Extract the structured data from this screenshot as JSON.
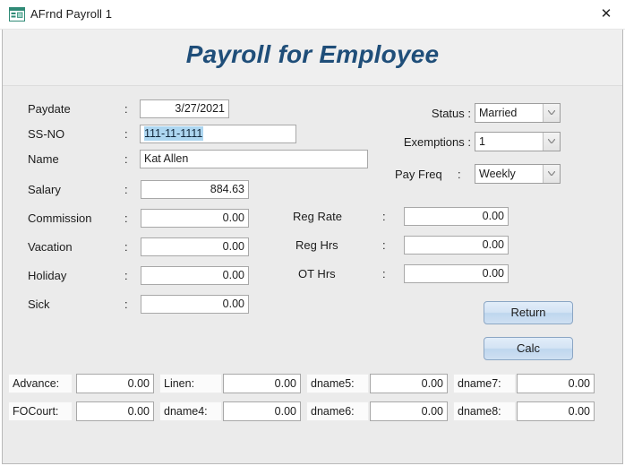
{
  "window": {
    "title": "AFrnd Payroll 1",
    "icon": "access-form-icon",
    "close_label": "✕"
  },
  "header": {
    "title": "Payroll for Employee",
    "title_color": "#1f4e79"
  },
  "colon": ":",
  "left_fields": [
    {
      "label": "Paydate",
      "value": "3/27/2021",
      "align": "right",
      "selected": false
    },
    {
      "label": "SS-NO",
      "value": "111-11-1111",
      "align": "left",
      "selected": true
    },
    {
      "label": "Name",
      "value": "Kat Allen",
      "align": "left",
      "selected": false
    },
    {
      "label": "Salary",
      "value": "884.63",
      "align": "right",
      "selected": false
    },
    {
      "label": "Commission",
      "value": "0.00",
      "align": "right",
      "selected": false
    },
    {
      "label": "Vacation",
      "value": "0.00",
      "align": "right",
      "selected": false
    },
    {
      "label": "Holiday",
      "value": "0.00",
      "align": "right",
      "selected": false
    },
    {
      "label": "Sick",
      "value": "0.00",
      "align": "right",
      "selected": false
    }
  ],
  "combos": [
    {
      "label": "Status :",
      "value": "Married"
    },
    {
      "label": "Exemptions :",
      "value": "1"
    },
    {
      "label": "Pay Freq",
      "value": "Weekly",
      "has_colon": true
    }
  ],
  "hour_fields": [
    {
      "label": "Reg Rate",
      "value": "0.00"
    },
    {
      "label": "Reg Hrs",
      "value": "0.00"
    },
    {
      "label": "OT Hrs",
      "value": "0.00"
    }
  ],
  "buttons": [
    {
      "label": "Return"
    },
    {
      "label": "Calc"
    }
  ],
  "deductions": [
    {
      "label": "Advance:",
      "value": "0.00"
    },
    {
      "label": "FOCourt:",
      "value": "0.00"
    },
    {
      "label": "Linen:",
      "value": "0.00"
    },
    {
      "label": "dname4:",
      "value": "0.00"
    },
    {
      "label": "dname5:",
      "value": "0.00"
    },
    {
      "label": "dname6:",
      "value": "0.00"
    },
    {
      "label": "dname7:",
      "value": "0.00"
    },
    {
      "label": "dname8:",
      "value": "0.00"
    }
  ]
}
